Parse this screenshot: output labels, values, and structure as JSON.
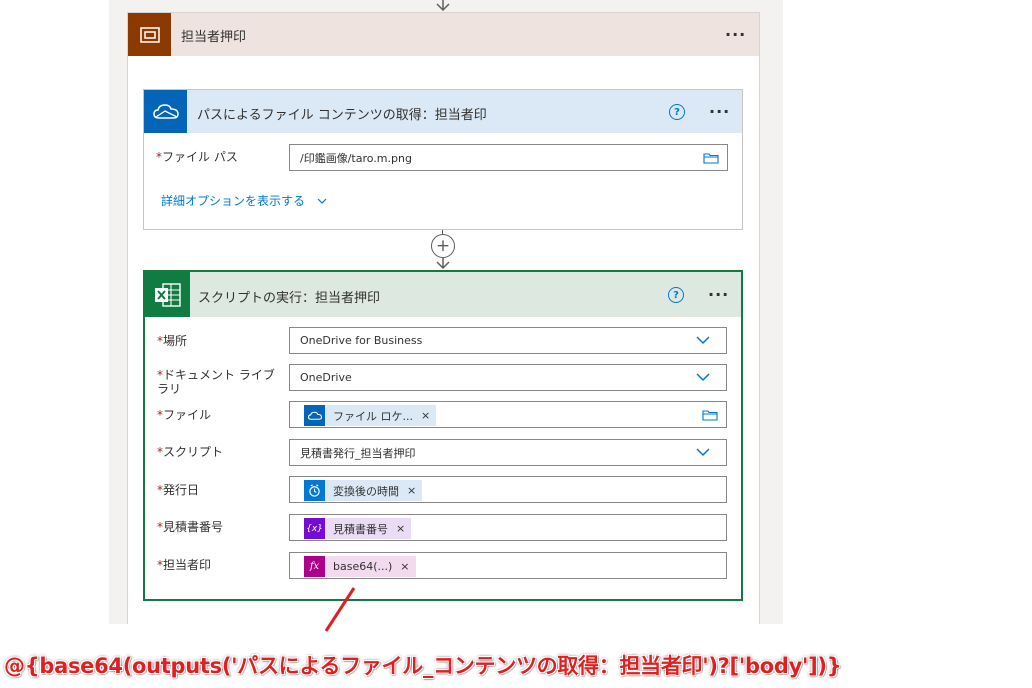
{
  "scope": {
    "title": "担当者押印",
    "more_label": "···"
  },
  "action_get_file": {
    "title": "パスによるファイル コンテンツの取得：担当者印",
    "help_label": "?",
    "more_label": "···",
    "fields": {
      "file_path": {
        "required_mark": "*",
        "label": "ファイル パス",
        "value": "/印鑑画像/taro.m.png"
      }
    },
    "advanced_options_label": "詳細オプションを表示する"
  },
  "add_step_label": "+",
  "action_run_script": {
    "title": "スクリプトの実行：担当者押印",
    "help_label": "?",
    "more_label": "···",
    "fields": {
      "location": {
        "required_mark": "*",
        "label": "場所",
        "value": "OneDrive for Business"
      },
      "document_library": {
        "required_mark": "*",
        "label": "ドキュメント ライブラリ",
        "value": "OneDrive"
      },
      "file": {
        "required_mark": "*",
        "label": "ファイル",
        "token": "ファイル ロケ...",
        "remove": "×"
      },
      "script": {
        "required_mark": "*",
        "label": "スクリプト",
        "value": "見積書発行_担当者押印"
      },
      "issue_date": {
        "required_mark": "*",
        "label": "発行日",
        "token": "変換後の時間",
        "remove": "×"
      },
      "quote_number": {
        "required_mark": "*",
        "label": "見積書番号",
        "token": "見積書番号",
        "token_icon": "{x}",
        "remove": "×"
      },
      "stamp": {
        "required_mark": "*",
        "label": "担当者印",
        "token": "base64(...)",
        "token_icon": "fx",
        "remove": "×"
      }
    }
  },
  "annotation": {
    "expression": "@{base64(outputs('パスによるファイル_コンテンツの取得：担当者印')?['body'])}",
    "color": "#e02020"
  },
  "colors": {
    "scope_accent": "#8c3900",
    "onedrive_blue": "#0364b8",
    "excel_green": "#107c41",
    "link_blue": "#0078d4",
    "required_red": "#a4262c"
  }
}
